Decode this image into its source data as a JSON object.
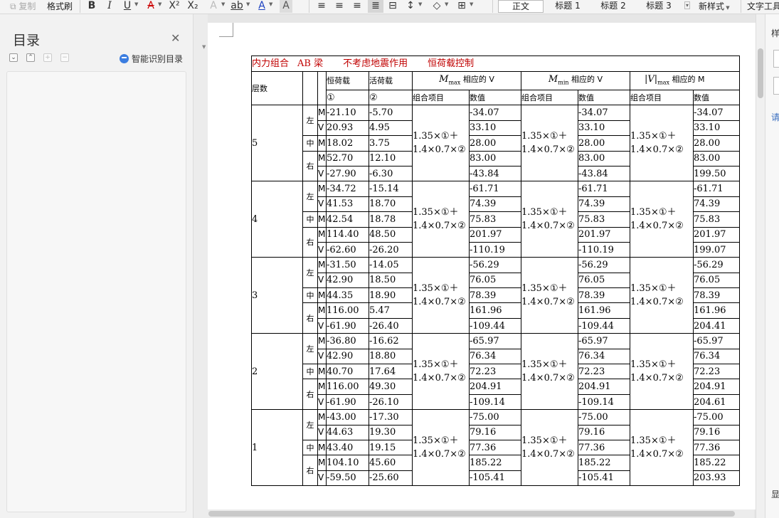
{
  "toolbar": {
    "copy": "复制",
    "format_painter": "格式刷",
    "styles": [
      "正文",
      "标题 1",
      "标题 2",
      "标题 3"
    ],
    "new_style": "新样式",
    "text_tools": "文字工具"
  },
  "sidebar": {
    "title": "目录",
    "smart_toc": "智能识别目录"
  },
  "table": {
    "title_parts": [
      "内力组合",
      "AB 梁",
      "不考虑地震作用",
      "恒荷载控制"
    ],
    "header": {
      "floor": "层数",
      "dead": "恒荷载",
      "live": "活荷载",
      "mmax_sym": "M",
      "mmax_sub": "max",
      "mmax_tail": " 相应的 V",
      "mmin_sym": "M",
      "mmin_sub": "min",
      "mmin_tail": " 相应的 V",
      "vmax_sym": "|V|",
      "vmax_sub": "max",
      "vmax_tail": "  相应的 M",
      "c1": "①",
      "c2": "②",
      "combo": "组合项目",
      "value": "数值"
    },
    "combo_formula": "1.35×①＋1.4×0.7×②",
    "positions": {
      "left": "左",
      "mid": "中",
      "right": "右"
    },
    "floors": [
      {
        "floor": "5",
        "rows": [
          {
            "mv": "M",
            "dead": "-21.10",
            "live": "-5.70",
            "v1": "-34.07",
            "v2": "-34.07",
            "v3": "-34.07"
          },
          {
            "mv": "V",
            "dead": "20.93",
            "live": "4.95",
            "v1": "33.10",
            "v2": "33.10",
            "v3": "33.10"
          },
          {
            "mv": "M",
            "dead": "18.02",
            "live": "3.75",
            "v1": "28.00",
            "v2": "28.00",
            "v3": "28.00"
          },
          {
            "mv": "M",
            "dead": "52.70",
            "live": "12.10",
            "v1": "83.00",
            "v2": "83.00",
            "v3": "83.00"
          },
          {
            "mv": "V",
            "dead": "-27.90",
            "live": "-6.30",
            "v1": "-43.84",
            "v2": "-43.84",
            "v3": "199.50"
          }
        ]
      },
      {
        "floor": "4",
        "rows": [
          {
            "mv": "M",
            "dead": "-34.72",
            "live": "-15.14",
            "v1": "-61.71",
            "v2": "-61.71",
            "v3": "-61.71"
          },
          {
            "mv": "V",
            "dead": "41.53",
            "live": "18.70",
            "v1": "74.39",
            "v2": "74.39",
            "v3": "74.39"
          },
          {
            "mv": "M",
            "dead": "42.54",
            "live": "18.78",
            "v1": "75.83",
            "v2": "75.83",
            "v3": "75.83"
          },
          {
            "mv": "M",
            "dead": "114.40",
            "live": "48.50",
            "v1": "201.97",
            "v2": "201.97",
            "v3": "201.97"
          },
          {
            "mv": "V",
            "dead": "-62.60",
            "live": "-26.20",
            "v1": "-110.19",
            "v2": "-110.19",
            "v3": "199.07"
          }
        ]
      },
      {
        "floor": "3",
        "rows": [
          {
            "mv": "M",
            "dead": "-31.50",
            "live": "-14.05",
            "v1": "-56.29",
            "v2": "-56.29",
            "v3": "-56.29"
          },
          {
            "mv": "V",
            "dead": "42.90",
            "live": "18.50",
            "v1": "76.05",
            "v2": "76.05",
            "v3": "76.05"
          },
          {
            "mv": "M",
            "dead": "44.35",
            "live": "18.90",
            "v1": "78.39",
            "v2": "78.39",
            "v3": "78.39"
          },
          {
            "mv": "M",
            "dead": "116.00",
            "live": "5.47",
            "v1": "161.96",
            "v2": "161.96",
            "v3": "161.96"
          },
          {
            "mv": "V",
            "dead": "-61.90",
            "live": "-26.40",
            "v1": "-109.44",
            "v2": "-109.44",
            "v3": "204.41"
          }
        ]
      },
      {
        "floor": "2",
        "rows": [
          {
            "mv": "M",
            "dead": "-36.80",
            "live": "-16.62",
            "v1": "-65.97",
            "v2": "-65.97",
            "v3": "-65.97"
          },
          {
            "mv": "V",
            "dead": "42.90",
            "live": "18.80",
            "v1": "76.34",
            "v2": "76.34",
            "v3": "76.34"
          },
          {
            "mv": "M",
            "dead": "40.70",
            "live": "17.64",
            "v1": "72.23",
            "v2": "72.23",
            "v3": "72.23"
          },
          {
            "mv": "M",
            "dead": "116.00",
            "live": "49.30",
            "v1": "204.91",
            "v2": "204.91",
            "v3": "204.91"
          },
          {
            "mv": "V",
            "dead": "-61.90",
            "live": "-26.10",
            "v1": "-109.14",
            "v2": "-109.14",
            "v3": "204.61"
          }
        ]
      },
      {
        "floor": "1",
        "rows": [
          {
            "mv": "M",
            "dead": "-43.00",
            "live": "-17.30",
            "v1": "-75.00",
            "v2": "-75.00",
            "v3": "-75.00"
          },
          {
            "mv": "V",
            "dead": "44.63",
            "live": "19.30",
            "v1": "79.16",
            "v2": "79.16",
            "v3": "79.16"
          },
          {
            "mv": "M",
            "dead": "43.40",
            "live": "19.15",
            "v1": "77.36",
            "v2": "77.36",
            "v3": "77.36"
          },
          {
            "mv": "M",
            "dead": "104.10",
            "live": "45.60",
            "v1": "185.22",
            "v2": "185.22",
            "v3": "185.22"
          },
          {
            "mv": "V",
            "dead": "-59.50",
            "live": "-25.60",
            "v1": "-105.41",
            "v2": "-105.41",
            "v3": "203.93"
          }
        ]
      }
    ]
  },
  "right_panel": {
    "chars": [
      "样",
      "请",
      "显"
    ]
  }
}
